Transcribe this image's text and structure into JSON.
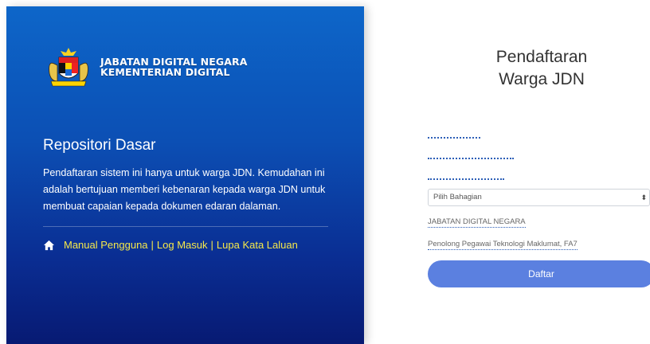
{
  "org": {
    "name": "JABATAN DIGITAL NEGARA",
    "ministry": "KEMENTERIAN DIGITAL"
  },
  "intro": {
    "title": "Repositori Dasar",
    "description": "Pendaftaran sistem ini hanya untuk warga JDN. Kemudahan ini adalah bertujuan memberi kebenaran kepada warga JDN untuk membuat capaian kepada dokumen edaran dalaman."
  },
  "links": {
    "manual": "Manual Pengguna",
    "login": "Log Masuk",
    "forgot": "Lupa Kata Laluan",
    "separator": "|",
    "icon": "home-icon"
  },
  "form": {
    "title_line1": "Pendaftaran",
    "title_line2": "Warga JDN",
    "division_placeholder": "Pilih Bahagian",
    "department_value": "JABATAN DIGITAL NEGARA",
    "position_value": "Penolong Pegawai Teknologi Maklumat, FA7",
    "submit_label": "Daftar"
  },
  "colors": {
    "link": "#f5e84a",
    "button": "#5b80e0",
    "panel_top": "#0d66c9",
    "panel_bottom": "#071a73"
  }
}
